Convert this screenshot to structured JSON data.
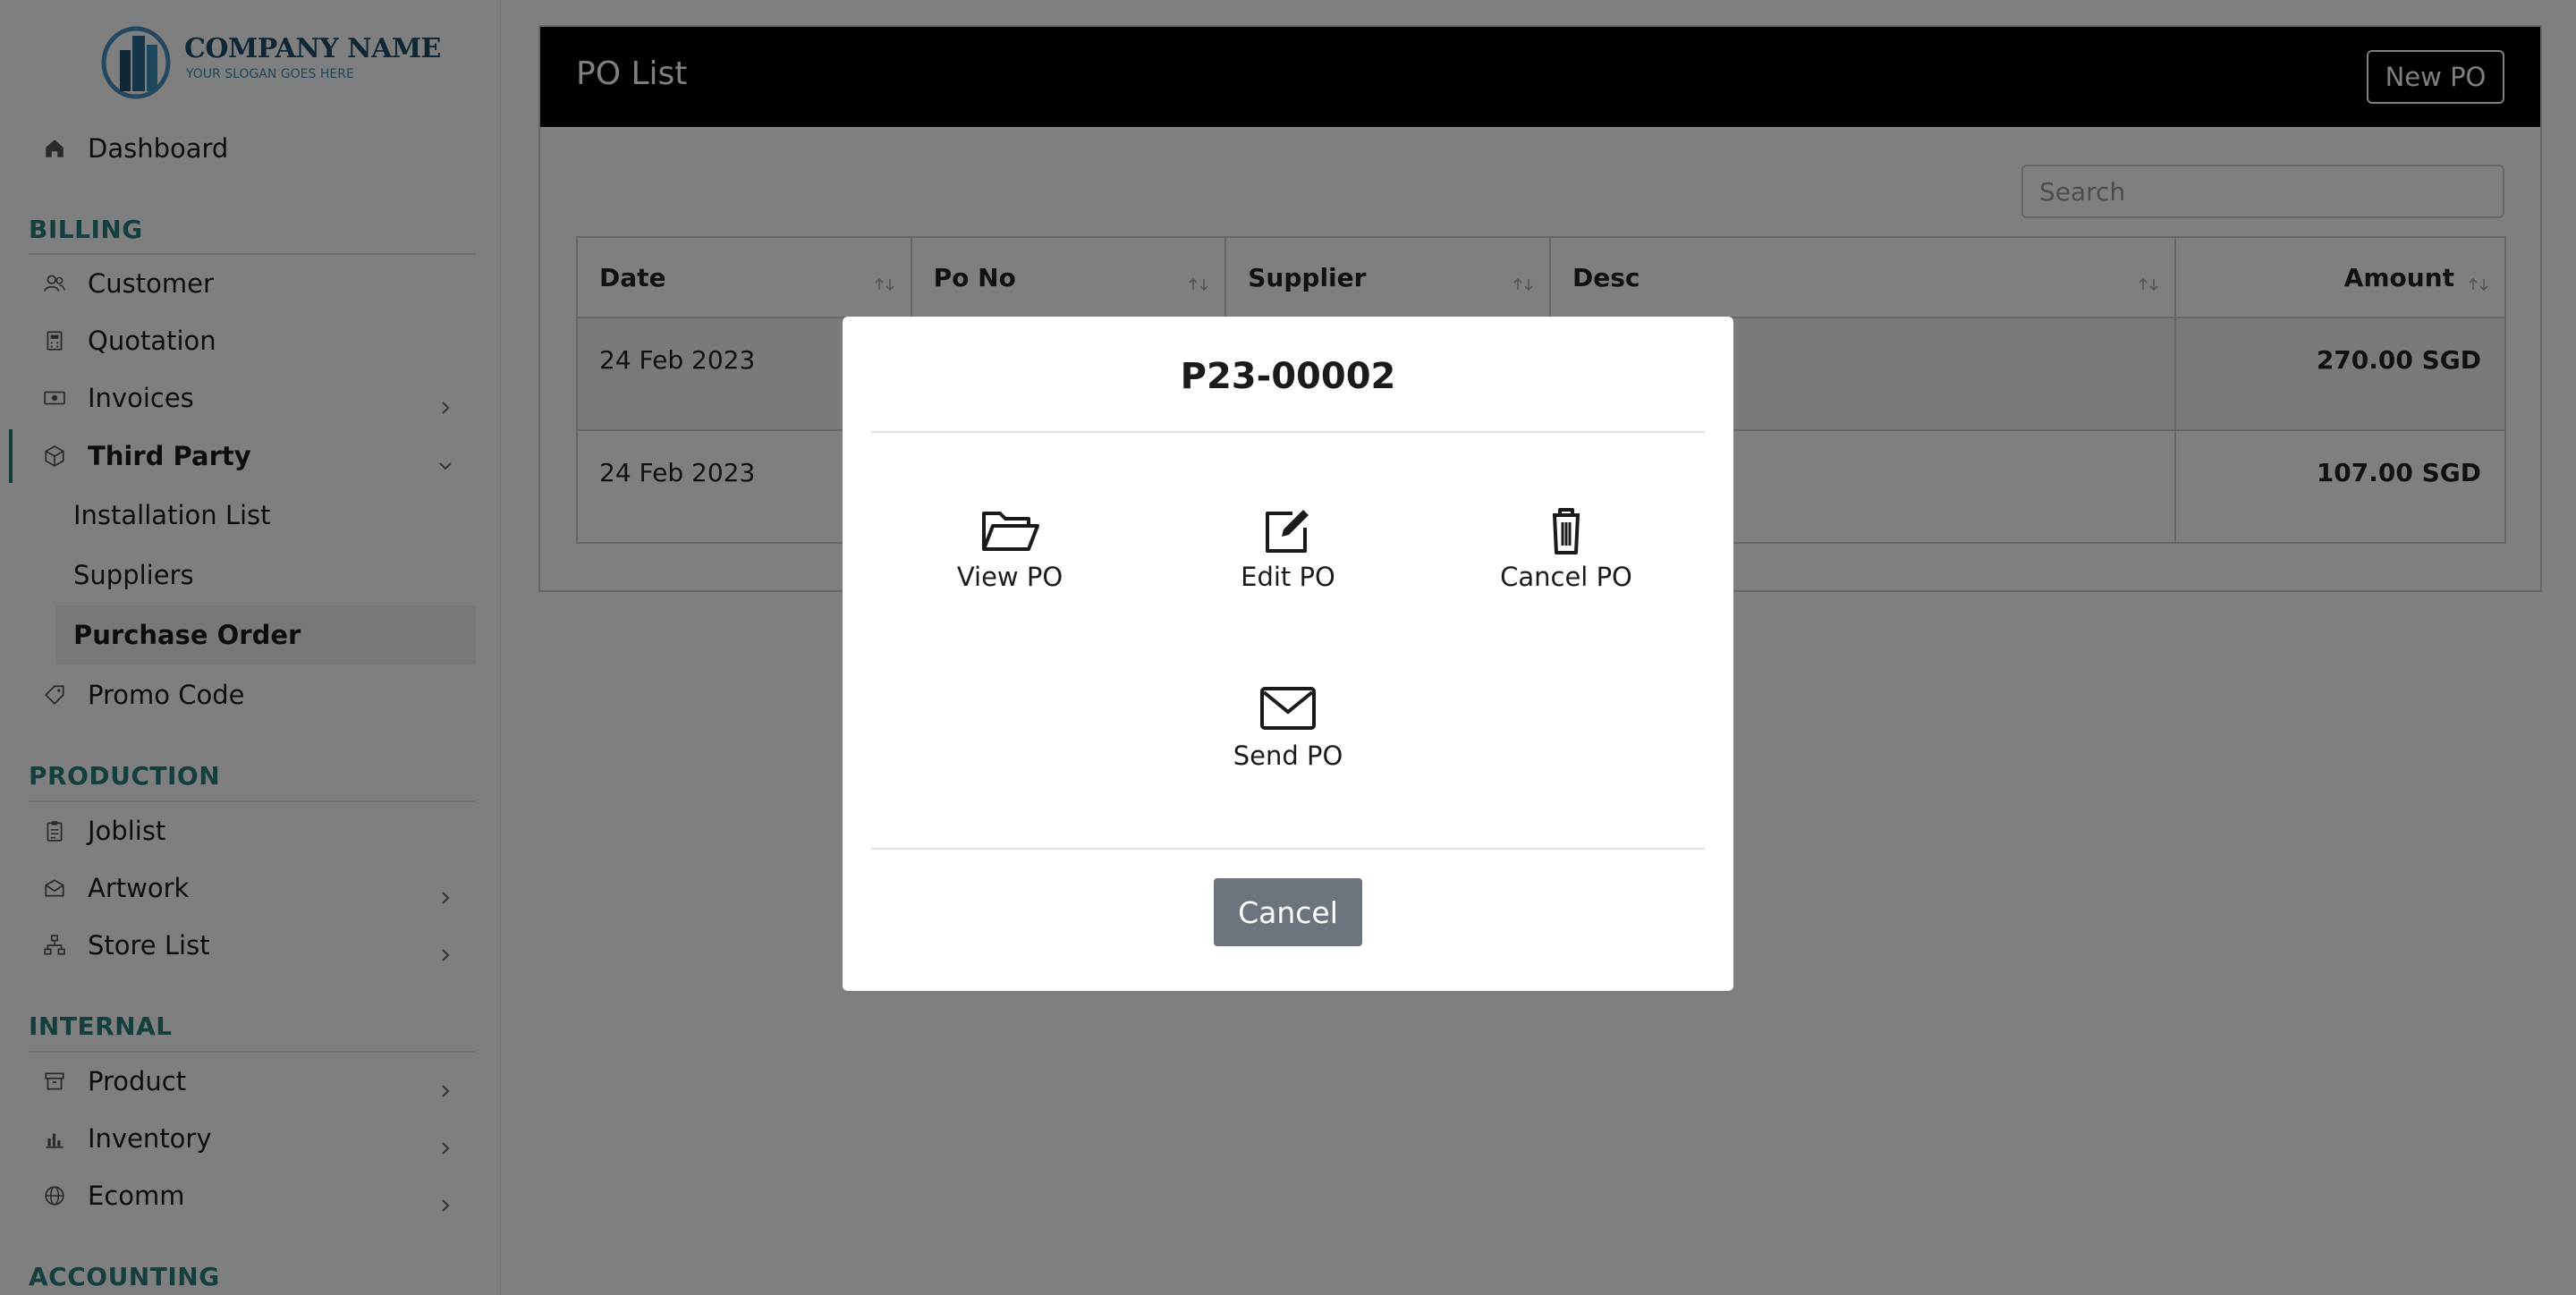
{
  "brand": {
    "name": "COMPANY NAME",
    "slogan": "YOUR SLOGAN GOES HERE"
  },
  "sidebar": {
    "dashboard": "Dashboard",
    "billing_section": "BILLING",
    "billing": {
      "customer": "Customer",
      "quotation": "Quotation",
      "invoices": "Invoices",
      "third_party": "Third Party",
      "third_party_sub": [
        "Installation List",
        "Suppliers",
        "Purchase Order"
      ],
      "promo_code": "Promo Code"
    },
    "production_section": "PRODUCTION",
    "production": {
      "joblist": "Joblist",
      "artwork": "Artwork",
      "store_list": "Store List"
    },
    "internal_section": "INTERNAL",
    "internal": {
      "product": "Product",
      "inventory": "Inventory",
      "ecomm": "Ecomm"
    },
    "accounting_section": "ACCOUNTING"
  },
  "page": {
    "title": "PO List",
    "new_button": "New PO",
    "search_placeholder": "Search",
    "columns": [
      "Date",
      "Po No",
      "Supplier",
      "Desc",
      "Amount"
    ],
    "rows": [
      {
        "date": "24 Feb 2023",
        "amount": "270.00 SGD"
      },
      {
        "date": "24 Feb 2023",
        "amount": "107.00 SGD"
      }
    ]
  },
  "modal": {
    "title": "P23-00002",
    "actions": {
      "view": "View PO",
      "edit": "Edit PO",
      "cancel_po": "Cancel PO",
      "send": "Send PO"
    },
    "cancel_button": "Cancel"
  },
  "colors": {
    "accent": "#2a7f7f",
    "header_bg": "#000000",
    "cancel_btn": "#6c757d"
  }
}
